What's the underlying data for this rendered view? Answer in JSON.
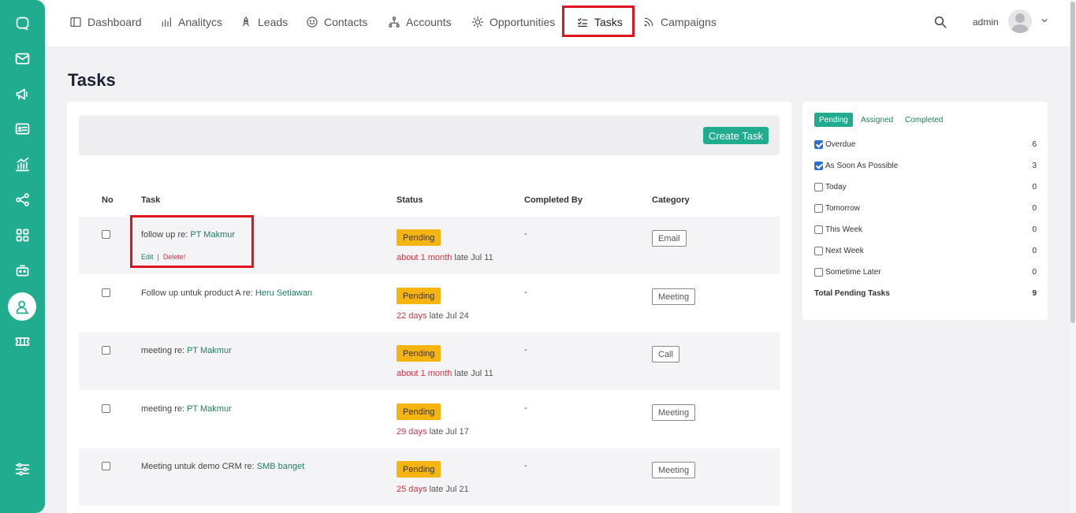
{
  "nav": {
    "items": [
      {
        "label": "Dashboard",
        "icon": "dashboard-icon"
      },
      {
        "label": "Analitycs",
        "icon": "bar-chart-icon"
      },
      {
        "label": "Leads",
        "icon": "rocket-icon"
      },
      {
        "label": "Contacts",
        "icon": "smile-icon"
      },
      {
        "label": "Accounts",
        "icon": "hierarchy-icon"
      },
      {
        "label": "Opportunities",
        "icon": "sun-icon"
      },
      {
        "label": "Tasks",
        "icon": "tasks-icon"
      },
      {
        "label": "Campaigns",
        "icon": "rss-icon"
      }
    ],
    "active": "Tasks",
    "user": "admin"
  },
  "sidebar": {
    "icons": [
      "chat-icon",
      "mail-icon",
      "megaphone-icon",
      "id-card-icon",
      "analytics-icon",
      "share-icon",
      "apps-grid-icon",
      "robot-icon",
      "user-profile-icon",
      "ticket-icon",
      "settings-sliders-icon"
    ],
    "active": "user-profile-icon"
  },
  "page": {
    "title": "Tasks",
    "create_button": "Create Task"
  },
  "table": {
    "headers": {
      "no": "No",
      "task": "Task",
      "status": "Status",
      "completed_by": "Completed By",
      "category": "Category"
    },
    "action_edit": "Edit",
    "action_sep": "|",
    "action_delete": "Delete!",
    "rows": [
      {
        "title": "follow up re: ",
        "related": "PT Makmur",
        "status": "Pending",
        "ago": "about 1 month",
        "late": " late Jul 11",
        "completed_by": "-",
        "category": "Email"
      },
      {
        "title": "Follow up untuk product A re: ",
        "related": "Heru Setiawan",
        "status": "Pending",
        "ago": "22 days",
        "late": " late Jul 24",
        "completed_by": "-",
        "category": "Meeting"
      },
      {
        "title": "meeting re: ",
        "related": "PT Makmur",
        "status": "Pending",
        "ago": "about 1 month",
        "late": " late Jul 11",
        "completed_by": "-",
        "category": "Call"
      },
      {
        "title": "meeting re: ",
        "related": "PT Makmur",
        "status": "Pending",
        "ago": "29 days",
        "late": " late Jul 17",
        "completed_by": "-",
        "category": "Meeting"
      },
      {
        "title": "Meeting untuk demo CRM re: ",
        "related": "SMB banget",
        "status": "Pending",
        "ago": "25 days",
        "late": " late Jul 21",
        "completed_by": "-",
        "category": "Meeting"
      }
    ]
  },
  "filters": {
    "tabs": [
      "Pending",
      "Assigned",
      "Completed"
    ],
    "active_tab": "Pending",
    "items": [
      {
        "label": "Overdue",
        "count": "6",
        "checked": true
      },
      {
        "label": "As Soon As Possible",
        "count": "3",
        "checked": true
      },
      {
        "label": "Today",
        "count": "0",
        "checked": false
      },
      {
        "label": "Tomorrow",
        "count": "0",
        "checked": false
      },
      {
        "label": "This Week",
        "count": "0",
        "checked": false
      },
      {
        "label": "Next Week",
        "count": "0",
        "checked": false
      },
      {
        "label": "Sometime Later",
        "count": "0",
        "checked": false
      }
    ],
    "total_label": "Total Pending Tasks",
    "total_count": "9"
  },
  "colors": {
    "accent": "#20ad8f",
    "pending": "#f6b411",
    "late": "#d63344",
    "highlight": "#e0141e"
  }
}
